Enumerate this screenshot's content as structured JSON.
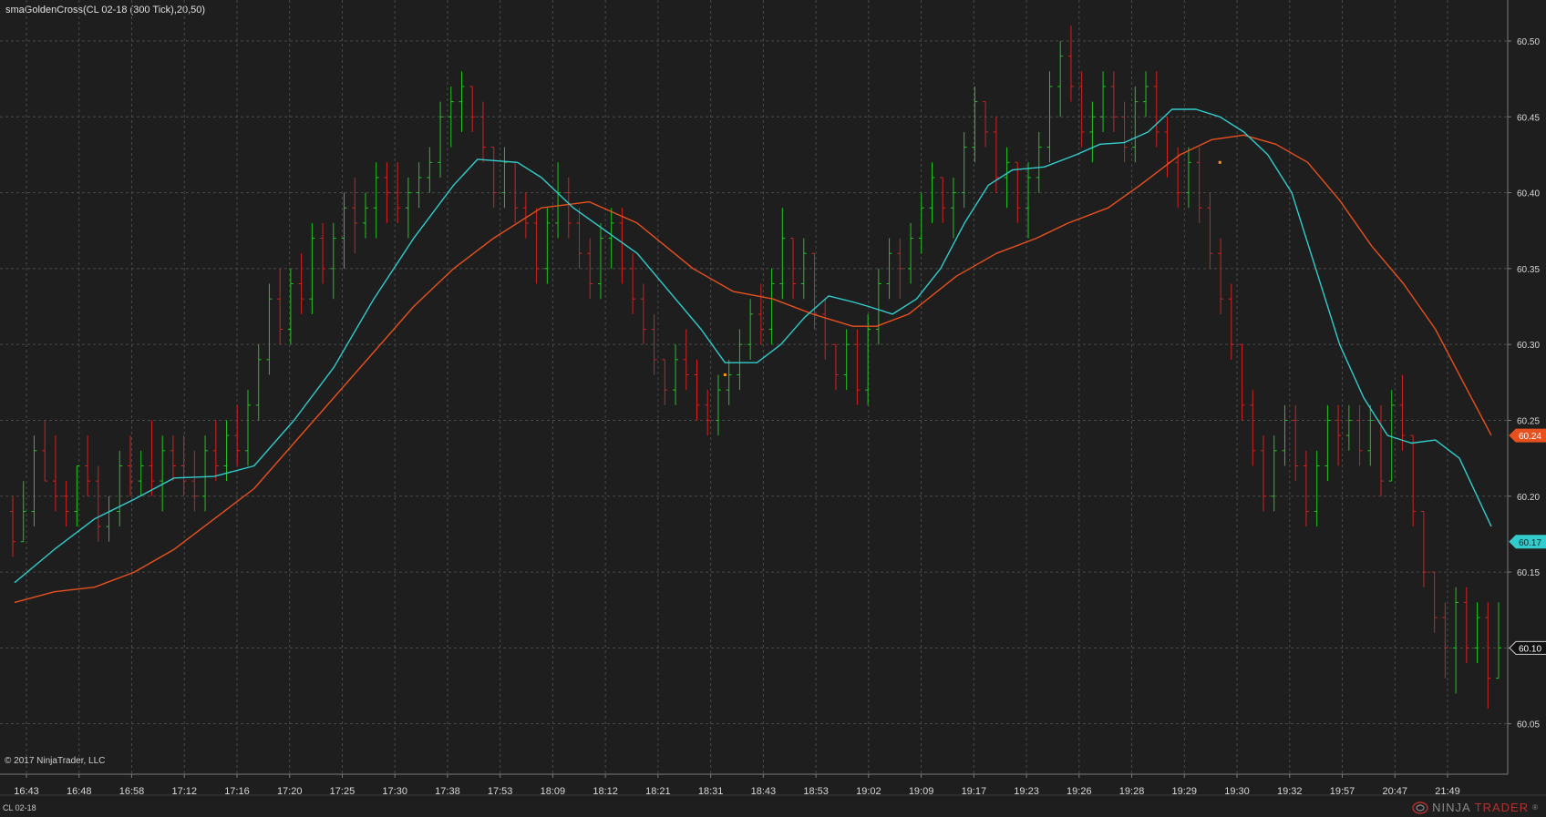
{
  "header": {
    "title": "smaGoldenCross(CL 02-18 (300 Tick),20,50)"
  },
  "footer": {
    "copyright": "© 2017 NinjaTrader, LLC",
    "instrument": "CL 02-18",
    "logo_ninja": "NINJA",
    "logo_trader": "TRADER",
    "logo_mark": "®"
  },
  "colors": {
    "background": "#1e1e1e",
    "grid": "#4a4a4a",
    "up_bar": "#22c322",
    "down_bar": "#d32020",
    "sma_fast": "#33cccc",
    "sma_slow": "#e8501e",
    "marker": "#ff9900"
  },
  "chart_data": {
    "type": "ohlc-bar",
    "instrument": "CL 02-18",
    "interval": "300 Tick",
    "y_ticks": [
      60.05,
      60.1,
      60.15,
      60.2,
      60.25,
      60.3,
      60.35,
      60.4,
      60.45,
      60.5
    ],
    "ylim": [
      60.03,
      60.515
    ],
    "x_tick_labels": [
      "16:43",
      "16:48",
      "16:58",
      "17:12",
      "17:16",
      "17:20",
      "17:25",
      "17:30",
      "17:38",
      "17:53",
      "18:09",
      "18:12",
      "18:21",
      "18:31",
      "18:43",
      "18:53",
      "19:02",
      "19:09",
      "19:17",
      "19:23",
      "19:26",
      "19:28",
      "19:29",
      "19:30",
      "19:32",
      "19:57",
      "20:47",
      "21:49"
    ],
    "bar_count": 140,
    "bars": [
      [
        60.19,
        60.2,
        60.16,
        60.17
      ],
      [
        60.17,
        60.21,
        60.17,
        60.19
      ],
      [
        60.19,
        60.24,
        60.18,
        60.23
      ],
      [
        60.23,
        60.25,
        60.21,
        60.21
      ],
      [
        60.21,
        60.24,
        60.19,
        60.2
      ],
      [
        60.2,
        60.21,
        60.18,
        60.19
      ],
      [
        60.19,
        60.22,
        60.18,
        60.22
      ],
      [
        60.22,
        60.24,
        60.2,
        60.21
      ],
      [
        60.21,
        60.22,
        60.17,
        60.18
      ],
      [
        60.18,
        60.2,
        60.17,
        60.19
      ],
      [
        60.19,
        60.23,
        60.18,
        60.22
      ],
      [
        60.22,
        60.24,
        60.2,
        60.21
      ],
      [
        60.21,
        60.23,
        60.2,
        60.22
      ],
      [
        60.22,
        60.25,
        60.2,
        60.21
      ],
      [
        60.21,
        60.24,
        60.19,
        60.23
      ],
      [
        60.23,
        60.24,
        60.21,
        60.22
      ],
      [
        60.22,
        60.24,
        60.2,
        60.21
      ],
      [
        60.21,
        60.23,
        60.19,
        60.2
      ],
      [
        60.2,
        60.24,
        60.19,
        60.23
      ],
      [
        60.23,
        60.25,
        60.21,
        60.22
      ],
      [
        60.22,
        60.25,
        60.21,
        60.24
      ],
      [
        60.24,
        60.26,
        60.22,
        60.23
      ],
      [
        60.23,
        60.27,
        60.22,
        60.26
      ],
      [
        60.26,
        60.3,
        60.25,
        60.29
      ],
      [
        60.29,
        60.34,
        60.28,
        60.33
      ],
      [
        60.33,
        60.35,
        60.3,
        60.31
      ],
      [
        60.31,
        60.35,
        60.3,
        60.34
      ],
      [
        60.34,
        60.36,
        60.32,
        60.33
      ],
      [
        60.33,
        60.38,
        60.32,
        60.37
      ],
      [
        60.37,
        60.38,
        60.34,
        60.35
      ],
      [
        60.35,
        60.38,
        60.33,
        60.37
      ],
      [
        60.37,
        60.4,
        60.35,
        60.39
      ],
      [
        60.39,
        60.41,
        60.36,
        60.38
      ],
      [
        60.38,
        60.4,
        60.37,
        60.39
      ],
      [
        60.39,
        60.42,
        60.37,
        60.41
      ],
      [
        60.41,
        60.42,
        60.38,
        60.4
      ],
      [
        60.4,
        60.42,
        60.38,
        60.39
      ],
      [
        60.39,
        60.41,
        60.37,
        60.4
      ],
      [
        60.4,
        60.42,
        60.39,
        60.41
      ],
      [
        60.41,
        60.43,
        60.4,
        60.42
      ],
      [
        60.42,
        60.46,
        60.41,
        60.45
      ],
      [
        60.45,
        60.47,
        60.43,
        60.46
      ],
      [
        60.46,
        60.48,
        60.44,
        60.47
      ],
      [
        60.47,
        60.47,
        60.44,
        60.45
      ],
      [
        60.45,
        60.46,
        60.42,
        60.43
      ],
      [
        60.43,
        60.43,
        60.39,
        60.4
      ],
      [
        60.4,
        60.43,
        60.39,
        60.42
      ],
      [
        60.42,
        60.42,
        60.38,
        60.39
      ],
      [
        60.39,
        60.4,
        60.37,
        60.38
      ],
      [
        60.38,
        60.39,
        60.34,
        60.35
      ],
      [
        60.35,
        60.39,
        60.34,
        60.38
      ],
      [
        60.38,
        60.42,
        60.37,
        60.4
      ],
      [
        60.4,
        60.41,
        60.37,
        60.38
      ],
      [
        60.38,
        60.39,
        60.35,
        60.36
      ],
      [
        60.36,
        60.37,
        60.33,
        60.34
      ],
      [
        60.34,
        60.38,
        60.33,
        60.37
      ],
      [
        60.37,
        60.39,
        60.35,
        60.38
      ],
      [
        60.38,
        60.39,
        60.34,
        60.35
      ],
      [
        60.35,
        60.36,
        60.32,
        60.33
      ],
      [
        60.33,
        60.34,
        60.3,
        60.31
      ],
      [
        60.31,
        60.32,
        60.28,
        60.29
      ],
      [
        60.29,
        60.29,
        60.26,
        60.27
      ],
      [
        60.27,
        60.3,
        60.26,
        60.29
      ],
      [
        60.29,
        60.31,
        60.27,
        60.28
      ],
      [
        60.28,
        60.29,
        60.25,
        60.26
      ],
      [
        60.26,
        60.27,
        60.24,
        60.25
      ],
      [
        60.25,
        60.28,
        60.24,
        60.27
      ],
      [
        60.27,
        60.29,
        60.26,
        60.28
      ],
      [
        60.28,
        60.31,
        60.27,
        60.3
      ],
      [
        60.3,
        60.33,
        60.29,
        60.32
      ],
      [
        60.32,
        60.34,
        60.3,
        60.31
      ],
      [
        60.31,
        60.35,
        60.3,
        60.34
      ],
      [
        60.34,
        60.39,
        60.33,
        60.37
      ],
      [
        60.37,
        60.37,
        60.33,
        60.34
      ],
      [
        60.34,
        60.37,
        60.33,
        60.36
      ],
      [
        60.36,
        60.36,
        60.31,
        60.32
      ],
      [
        60.32,
        60.33,
        60.29,
        60.3
      ],
      [
        60.3,
        60.3,
        60.27,
        60.28
      ],
      [
        60.28,
        60.31,
        60.27,
        60.3
      ],
      [
        60.3,
        60.31,
        60.26,
        60.27
      ],
      [
        60.27,
        60.32,
        60.26,
        60.31
      ],
      [
        60.31,
        60.35,
        60.3,
        60.34
      ],
      [
        60.34,
        60.37,
        60.33,
        60.36
      ],
      [
        60.36,
        60.37,
        60.33,
        60.35
      ],
      [
        60.35,
        60.38,
        60.34,
        60.37
      ],
      [
        60.37,
        60.4,
        60.36,
        60.39
      ],
      [
        60.39,
        60.42,
        60.38,
        60.41
      ],
      [
        60.41,
        60.41,
        60.38,
        60.39
      ],
      [
        60.39,
        60.41,
        60.37,
        60.4
      ],
      [
        60.4,
        60.44,
        60.39,
        60.43
      ],
      [
        60.43,
        60.47,
        60.42,
        60.46
      ],
      [
        60.46,
        60.46,
        60.43,
        60.44
      ],
      [
        60.44,
        60.45,
        60.4,
        60.41
      ],
      [
        60.41,
        60.43,
        60.39,
        60.42
      ],
      [
        60.42,
        60.42,
        60.38,
        60.39
      ],
      [
        60.39,
        60.42,
        60.37,
        60.41
      ],
      [
        60.41,
        60.44,
        60.4,
        60.43
      ],
      [
        60.43,
        60.48,
        60.42,
        60.47
      ],
      [
        60.47,
        60.5,
        60.45,
        60.49
      ],
      [
        60.49,
        60.51,
        60.46,
        60.47
      ],
      [
        60.47,
        60.48,
        60.43,
        60.44
      ],
      [
        60.44,
        60.46,
        60.42,
        60.45
      ],
      [
        60.45,
        60.48,
        60.44,
        60.47
      ],
      [
        60.47,
        60.48,
        60.44,
        60.45
      ],
      [
        60.45,
        60.46,
        60.42,
        60.43
      ],
      [
        60.43,
        60.47,
        60.42,
        60.46
      ],
      [
        60.46,
        60.48,
        60.45,
        60.47
      ],
      [
        60.47,
        60.48,
        60.43,
        60.44
      ],
      [
        60.44,
        60.45,
        60.41,
        60.42
      ],
      [
        60.42,
        60.43,
        60.39,
        60.4
      ],
      [
        60.4,
        60.43,
        60.39,
        60.42
      ],
      [
        60.42,
        60.43,
        60.38,
        60.39
      ],
      [
        60.39,
        60.4,
        60.35,
        60.36
      ],
      [
        60.36,
        60.37,
        60.32,
        60.33
      ],
      [
        60.33,
        60.34,
        60.29,
        60.3
      ],
      [
        60.3,
        60.3,
        60.25,
        60.26
      ],
      [
        60.26,
        60.27,
        60.22,
        60.23
      ],
      [
        60.23,
        60.24,
        60.19,
        60.2
      ],
      [
        60.2,
        60.24,
        60.19,
        60.23
      ],
      [
        60.23,
        60.26,
        60.22,
        60.25
      ],
      [
        60.25,
        60.26,
        60.21,
        60.22
      ],
      [
        60.22,
        60.23,
        60.18,
        60.19
      ],
      [
        60.19,
        60.23,
        60.18,
        60.22
      ],
      [
        60.22,
        60.26,
        60.21,
        60.25
      ],
      [
        60.25,
        60.26,
        60.22,
        60.24
      ],
      [
        60.24,
        60.26,
        60.23,
        60.25
      ],
      [
        60.25,
        60.26,
        60.22,
        60.23
      ],
      [
        60.23,
        60.26,
        60.22,
        60.25
      ],
      [
        60.25,
        60.26,
        60.2,
        60.21
      ],
      [
        60.21,
        60.27,
        60.21,
        60.26
      ],
      [
        60.26,
        60.28,
        60.23,
        60.24
      ],
      [
        60.24,
        60.24,
        60.18,
        60.19
      ],
      [
        60.19,
        60.19,
        60.14,
        60.15
      ],
      [
        60.15,
        60.15,
        60.11,
        60.12
      ],
      [
        60.12,
        60.13,
        60.08,
        60.1
      ],
      [
        60.1,
        60.14,
        60.07,
        60.13
      ],
      [
        60.13,
        60.14,
        60.09,
        60.1
      ],
      [
        60.1,
        60.13,
        60.09,
        60.12
      ],
      [
        60.12,
        60.13,
        60.06,
        60.08
      ],
      [
        60.08,
        60.13,
        60.08,
        60.1
      ]
    ],
    "sma_fast": {
      "name": "SMA 20",
      "last": 60.17,
      "values": [
        [
          0,
          60.143
        ],
        [
          5,
          60.165
        ],
        [
          10,
          60.185
        ],
        [
          15,
          60.198
        ],
        [
          20,
          60.212
        ],
        [
          25,
          60.213
        ],
        [
          30,
          60.22
        ],
        [
          35,
          60.25
        ],
        [
          40,
          60.285
        ],
        [
          45,
          60.33
        ],
        [
          50,
          60.37
        ],
        [
          55,
          60.405
        ],
        [
          58,
          60.422
        ],
        [
          63,
          60.42
        ],
        [
          66,
          60.41
        ],
        [
          70,
          60.39
        ],
        [
          74,
          60.375
        ],
        [
          78,
          60.36
        ],
        [
          82,
          60.335
        ],
        [
          86,
          60.31
        ],
        [
          89,
          60.288
        ],
        [
          93,
          60.288
        ],
        [
          96,
          60.3
        ],
        [
          99,
          60.318
        ],
        [
          102,
          60.332
        ],
        [
          105,
          60.328
        ],
        [
          107,
          60.325
        ],
        [
          110,
          60.32
        ],
        [
          113,
          60.33
        ],
        [
          116,
          60.35
        ],
        [
          119,
          60.38
        ],
        [
          122,
          60.405
        ],
        [
          125,
          60.415
        ],
        [
          129,
          60.417
        ],
        [
          133,
          60.425
        ],
        [
          136,
          60.432
        ],
        [
          139,
          60.433
        ],
        [
          142,
          60.44
        ],
        [
          145,
          60.455
        ],
        [
          148,
          60.455
        ],
        [
          151,
          60.45
        ],
        [
          154,
          60.44
        ],
        [
          157,
          60.425
        ],
        [
          160,
          60.4
        ],
        [
          163,
          60.35
        ],
        [
          166,
          60.3
        ],
        [
          169,
          60.265
        ],
        [
          172,
          60.24
        ],
        [
          175,
          60.235
        ],
        [
          178,
          60.237
        ],
        [
          181,
          60.225
        ],
        [
          185,
          60.18
        ]
      ]
    },
    "sma_slow": {
      "name": "SMA 50",
      "last": 60.24,
      "values": [
        [
          0,
          60.13
        ],
        [
          5,
          60.137
        ],
        [
          10,
          60.14
        ],
        [
          15,
          60.15
        ],
        [
          20,
          60.165
        ],
        [
          25,
          60.185
        ],
        [
          30,
          60.205
        ],
        [
          35,
          60.235
        ],
        [
          40,
          60.265
        ],
        [
          45,
          60.295
        ],
        [
          50,
          60.325
        ],
        [
          55,
          60.35
        ],
        [
          60,
          60.37
        ],
        [
          66,
          60.39
        ],
        [
          72,
          60.394
        ],
        [
          78,
          60.38
        ],
        [
          85,
          60.35
        ],
        [
          90,
          60.335
        ],
        [
          95,
          60.33
        ],
        [
          100,
          60.32
        ],
        [
          105,
          60.312
        ],
        [
          108,
          60.312
        ],
        [
          112,
          60.32
        ],
        [
          118,
          60.345
        ],
        [
          123,
          60.36
        ],
        [
          128,
          60.37
        ],
        [
          132,
          60.38
        ],
        [
          137,
          60.39
        ],
        [
          141,
          60.405
        ],
        [
          146,
          60.425
        ],
        [
          150,
          60.435
        ],
        [
          154,
          60.438
        ],
        [
          158,
          60.432
        ],
        [
          162,
          60.42
        ],
        [
          166,
          60.395
        ],
        [
          170,
          60.365
        ],
        [
          174,
          60.34
        ],
        [
          178,
          60.31
        ],
        [
          182,
          60.27
        ],
        [
          185,
          60.24
        ]
      ]
    },
    "price_markers": [
      {
        "label": "60.24",
        "color": "#e8501e"
      },
      {
        "label": "60.17",
        "color": "#33cccc"
      },
      {
        "label": "60.10",
        "color": "#111111"
      }
    ],
    "signal_dots": [
      [
        89,
        60.28
      ],
      [
        151,
        60.42
      ]
    ]
  }
}
